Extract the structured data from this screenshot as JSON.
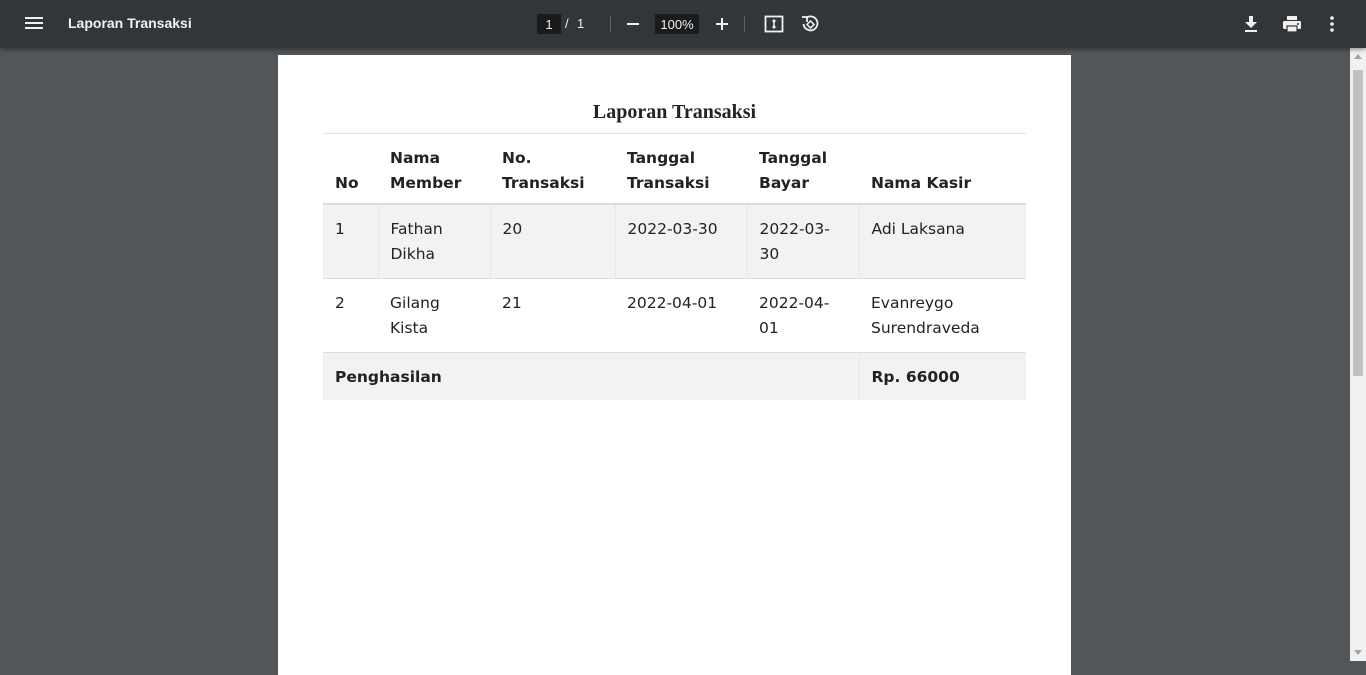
{
  "toolbar": {
    "title": "Laporan Transaksi",
    "page_current": "1",
    "page_separator": "/",
    "page_total": "1",
    "zoom": "100%",
    "icons": [
      "menu-icon",
      "zoom-out-icon",
      "zoom-in-icon",
      "fit-page-icon",
      "rotate-icon",
      "download-icon",
      "print-icon",
      "more-options-icon"
    ]
  },
  "document": {
    "title": "Laporan Transaksi",
    "table": {
      "headers": [
        {
          "line1": "",
          "line2": "No"
        },
        {
          "line1": "Nama",
          "line2": "Member"
        },
        {
          "line1": "No.",
          "line2": "Transaksi"
        },
        {
          "line1": "Tanggal",
          "line2": "Transaksi"
        },
        {
          "line1": "Tanggal",
          "line2": "Bayar"
        },
        {
          "line1": "",
          "line2": "Nama Kasir"
        }
      ],
      "rows": [
        {
          "no": "1",
          "member_1": "Fathan",
          "member_2": "Dikha",
          "transaksi": "20",
          "tgl_transaksi": "2022-03-30",
          "tgl_bayar": "2022-03-30",
          "kasir_1": "Adi Laksana",
          "kasir_2": ""
        },
        {
          "no": "2",
          "member_1": "Gilang Kista",
          "member_2": "",
          "transaksi": "21",
          "tgl_transaksi": "2022-04-01",
          "tgl_bayar": "2022-04-01",
          "kasir_1": "Evanreygo",
          "kasir_2": "Surendraveda"
        }
      ],
      "footer": {
        "label": "Penghasilan",
        "amount": "Rp. 66000"
      }
    }
  }
}
